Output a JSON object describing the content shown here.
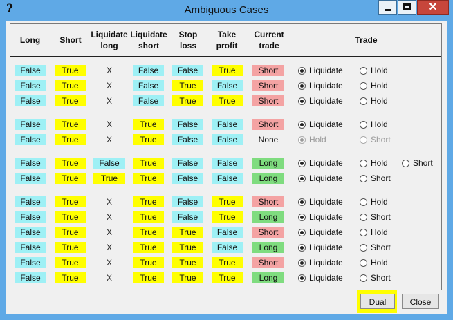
{
  "window": {
    "title": "Ambiguous Cases",
    "help_glyph": "?",
    "close_glyph": "✕"
  },
  "headers": {
    "long": "Long",
    "short": "Short",
    "liquidate_long": [
      "Liquidate",
      "long"
    ],
    "liquidate_short": [
      "Liquidate",
      "short"
    ],
    "stop_loss": [
      "Stop",
      "loss"
    ],
    "take_profit": [
      "Take",
      "profit"
    ],
    "current_trade": [
      "Current",
      "trade"
    ],
    "trade": "Trade"
  },
  "rows": [
    {
      "long": "False",
      "short": "True",
      "liq_long": "X",
      "liq_short": "False",
      "stop_loss": "False",
      "take_profit": "True",
      "current": "Short",
      "current_color": "pink",
      "options": [
        {
          "label": "Liquidate",
          "selected": true
        },
        {
          "label": "Hold",
          "selected": false
        }
      ],
      "disabled": false
    },
    {
      "long": "False",
      "short": "True",
      "liq_long": "X",
      "liq_short": "False",
      "stop_loss": "True",
      "take_profit": "False",
      "current": "Short",
      "current_color": "pink",
      "options": [
        {
          "label": "Liquidate",
          "selected": true
        },
        {
          "label": "Hold",
          "selected": false
        }
      ],
      "disabled": false
    },
    {
      "long": "False",
      "short": "True",
      "liq_long": "X",
      "liq_short": "False",
      "stop_loss": "True",
      "take_profit": "True",
      "current": "Short",
      "current_color": "pink",
      "options": [
        {
          "label": "Liquidate",
          "selected": true
        },
        {
          "label": "Hold",
          "selected": false
        }
      ],
      "disabled": false
    },
    {
      "long": "False",
      "short": "True",
      "liq_long": "X",
      "liq_short": "True",
      "stop_loss": "False",
      "take_profit": "False",
      "current": "Short",
      "current_color": "pink",
      "options": [
        {
          "label": "Liquidate",
          "selected": true
        },
        {
          "label": "Hold",
          "selected": false
        }
      ],
      "disabled": false
    },
    {
      "long": "False",
      "short": "True",
      "liq_long": "X",
      "liq_short": "True",
      "stop_loss": "False",
      "take_profit": "False",
      "current": "None",
      "current_color": "plain",
      "options": [
        {
          "label": "Hold",
          "selected": true
        },
        {
          "label": "Short",
          "selected": false
        }
      ],
      "disabled": true
    },
    {
      "long": "False",
      "short": "True",
      "liq_long": "False",
      "liq_short": "True",
      "stop_loss": "False",
      "take_profit": "False",
      "current": "Long",
      "current_color": "green",
      "options": [
        {
          "label": "Liquidate",
          "selected": true
        },
        {
          "label": "Hold",
          "selected": false
        },
        {
          "label": "Short",
          "selected": false
        }
      ],
      "disabled": false
    },
    {
      "long": "False",
      "short": "True",
      "liq_long": "True",
      "liq_short": "True",
      "stop_loss": "False",
      "take_profit": "False",
      "current": "Long",
      "current_color": "green",
      "options": [
        {
          "label": "Liquidate",
          "selected": true
        },
        {
          "label": "Short",
          "selected": false
        }
      ],
      "disabled": false
    },
    {
      "long": "False",
      "short": "True",
      "liq_long": "X",
      "liq_short": "True",
      "stop_loss": "False",
      "take_profit": "True",
      "current": "Short",
      "current_color": "pink",
      "options": [
        {
          "label": "Liquidate",
          "selected": true
        },
        {
          "label": "Hold",
          "selected": false
        }
      ],
      "disabled": false
    },
    {
      "long": "False",
      "short": "True",
      "liq_long": "X",
      "liq_short": "True",
      "stop_loss": "False",
      "take_profit": "True",
      "current": "Long",
      "current_color": "green",
      "options": [
        {
          "label": "Liquidate",
          "selected": true
        },
        {
          "label": "Short",
          "selected": false
        }
      ],
      "disabled": false
    },
    {
      "long": "False",
      "short": "True",
      "liq_long": "X",
      "liq_short": "True",
      "stop_loss": "True",
      "take_profit": "False",
      "current": "Short",
      "current_color": "pink",
      "options": [
        {
          "label": "Liquidate",
          "selected": true
        },
        {
          "label": "Hold",
          "selected": false
        }
      ],
      "disabled": false
    },
    {
      "long": "False",
      "short": "True",
      "liq_long": "X",
      "liq_short": "True",
      "stop_loss": "True",
      "take_profit": "False",
      "current": "Long",
      "current_color": "green",
      "options": [
        {
          "label": "Liquidate",
          "selected": true
        },
        {
          "label": "Short",
          "selected": false
        }
      ],
      "disabled": false
    },
    {
      "long": "False",
      "short": "True",
      "liq_long": "X",
      "liq_short": "True",
      "stop_loss": "True",
      "take_profit": "True",
      "current": "Short",
      "current_color": "pink",
      "options": [
        {
          "label": "Liquidate",
          "selected": true
        },
        {
          "label": "Hold",
          "selected": false
        }
      ],
      "disabled": false
    },
    {
      "long": "False",
      "short": "True",
      "liq_long": "X",
      "liq_short": "True",
      "stop_loss": "True",
      "take_profit": "True",
      "current": "Long",
      "current_color": "green",
      "options": [
        {
          "label": "Liquidate",
          "selected": true
        },
        {
          "label": "Short",
          "selected": false
        }
      ],
      "disabled": false
    }
  ],
  "buttons": {
    "dual": "Dual",
    "close": "Close"
  },
  "colors": {
    "false": "#9ef0f5",
    "true": "#ffff00",
    "short": "#f4a3a3",
    "long": "#7fdc7f",
    "highlight": "#ffff00"
  }
}
